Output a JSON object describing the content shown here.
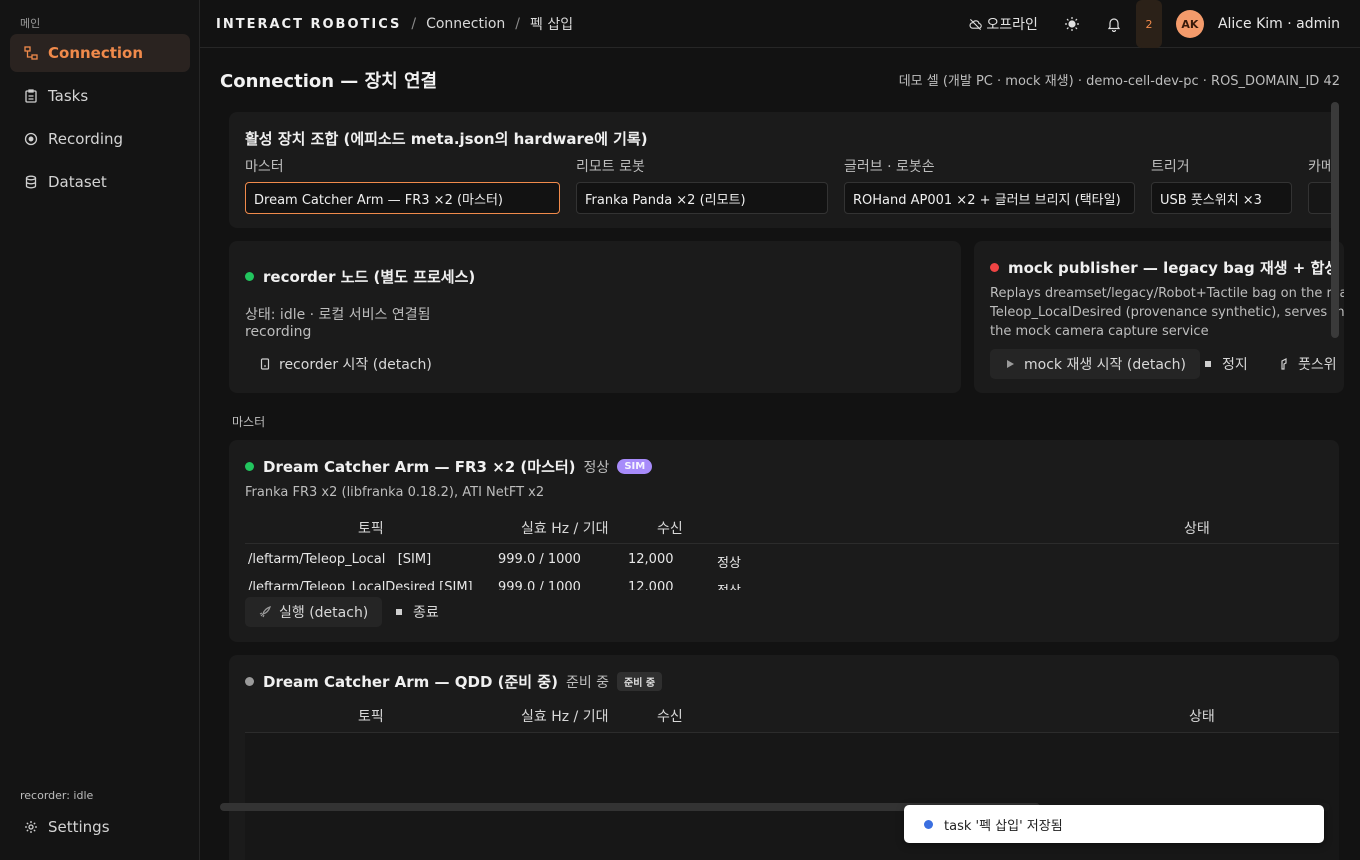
{
  "sidebar": {
    "section": "메인",
    "items": [
      {
        "label": "Connection",
        "icon": "connection-icon",
        "active": true
      },
      {
        "label": "Tasks",
        "icon": "clipboard-icon"
      },
      {
        "label": "Recording",
        "icon": "record-icon"
      },
      {
        "label": "Dataset",
        "icon": "database-icon"
      }
    ],
    "status": "recorder: idle",
    "settings": "Settings"
  },
  "header": {
    "brand": "INTERACT ROBOTICS",
    "crumb1": "Connection",
    "crumb2": "펙 삽입",
    "separator": "/",
    "offline": "오프라인",
    "notif_count": "2",
    "avatar": "AK",
    "user": "Alice Kim · admin"
  },
  "page": {
    "title": "Connection — 장치 연결",
    "env": "데모 셀 (개발 PC · mock 재생) · demo-cell-dev-pc · ROS_DOMAIN_ID 42"
  },
  "combo": {
    "title": "활성 장치 조합 (에피소드 meta.json의 hardware에 기록)",
    "fields": [
      {
        "label": "마스터",
        "value": "Dream Catcher Arm — FR3 ×2 (마스터)"
      },
      {
        "label": "리모트 로봇",
        "value": "Franka Panda ×2 (리모트)"
      },
      {
        "label": "글러브 · 로봇손",
        "value": "ROHand AP001 ×2 + 글러브 브리지 (택타일)"
      },
      {
        "label": "트리거",
        "value": "USB 풋스위치 ×3"
      },
      {
        "label": "카메",
        "value": ""
      }
    ]
  },
  "recorder": {
    "title": "recorder 노드 (별도 프로세스)",
    "status": "상태: idle · 로컬 서비스 연결됨",
    "status2": "recording",
    "start": "recorder 시작 (detach)",
    "color": "#22c55e"
  },
  "publisher": {
    "title": "mock publisher — legacy bag 재생 + 합성 명령 채널",
    "desc1": "Replays dreamset/legacy/Robot+Tactile bag on the real t",
    "desc2": "Teleop_LocalDesired (provenance synthetic), serves the",
    "desc3": "the mock camera capture service",
    "play": "mock 재생 시작 (detach)",
    "stop": "정지",
    "foot": "풋스위",
    "color": "#ef4444"
  },
  "section_label": "마스터",
  "device1": {
    "name": "Dream Catcher Arm — FR3 ×2 (마스터)",
    "state": "정상",
    "badge": "SIM",
    "sub": "Franka FR3 x2 (libfranka 0.18.2), ATI NetFT x2",
    "cols": {
      "topic": "토픽",
      "hz": "실효 Hz / 기대",
      "recv": "수신",
      "status": "상태"
    },
    "rows": [
      {
        "topic": "/leftarm/Teleop_Local",
        "tag": "[SIM]",
        "hz": "999.0 / 1000",
        "recv": "12,000",
        "status": "정상"
      },
      {
        "topic": "/leftarm/Teleop_LocalDesired",
        "tag": "[SIM]",
        "hz": "999.0 / 1000",
        "recv": "12,000",
        "status": "정상"
      }
    ],
    "run": "실행 (detach)",
    "end": "종료"
  },
  "device2": {
    "name": "Dream Catcher Arm — QDD (준비 중)",
    "state": "준비 중",
    "badge": "준비 중",
    "cols": {
      "topic": "토픽",
      "hz": "실효 Hz / 기대",
      "recv": "수신",
      "status": "상태"
    }
  },
  "toast": {
    "text": "task '펙 삽입' 저장됨"
  }
}
